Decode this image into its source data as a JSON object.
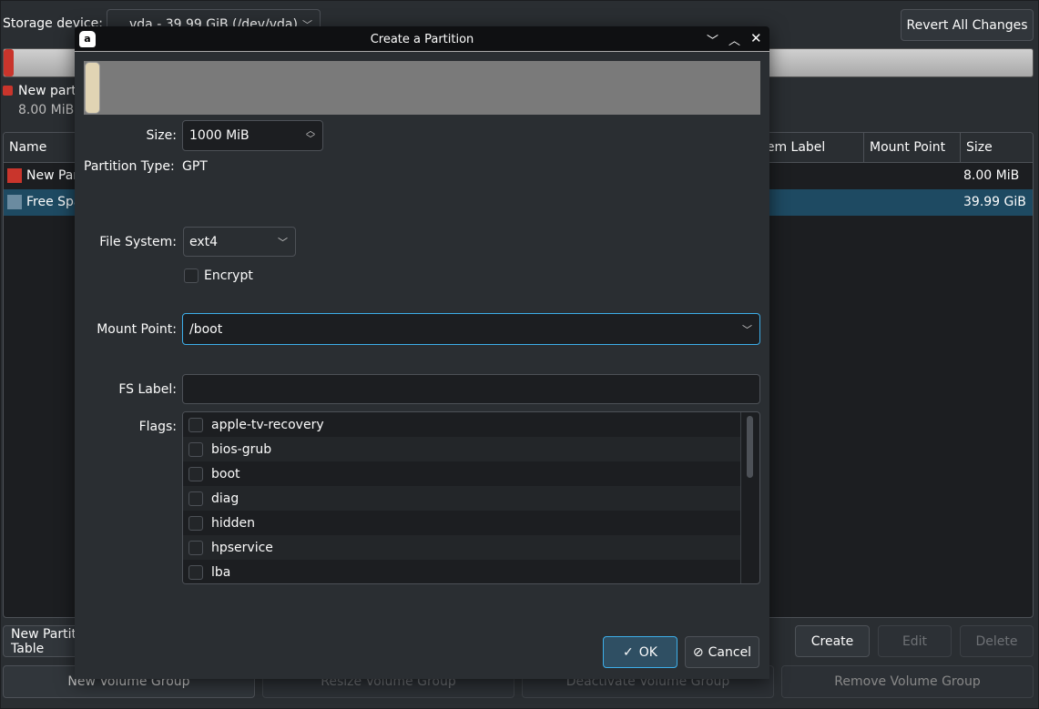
{
  "main": {
    "storage_label": "Storage device:",
    "storage_value": "vda - 39.99 GiB (/dev/vda)",
    "revert_button": "Revert All Changes",
    "legend": {
      "name": "New partition",
      "size": "8.00 MiB"
    },
    "table": {
      "columns": [
        "Name",
        "File System Label",
        "Mount Point",
        "Size"
      ],
      "rows": [
        {
          "name": "New Partition",
          "size": "8.00 MiB",
          "color": "#c9352c"
        },
        {
          "name": "Free Space",
          "size": "39.99 GiB",
          "color": "#6b8ba0"
        }
      ]
    },
    "buttons": {
      "new_partition": "New Partition Table",
      "create": "Create",
      "edit": "Edit",
      "delete": "Delete",
      "new_vg": "New Volume Group",
      "resize_vg": "Resize Volume Group",
      "deactivate_vg": "Deactivate Volume Group",
      "remove_vg": "Remove Volume Group"
    }
  },
  "dialog": {
    "title": "Create a Partition",
    "size_label": "Size:",
    "size_value": "1000 MiB",
    "ptype_label": "Partition Type:",
    "ptype_value": "GPT",
    "fs_label": "File System:",
    "fs_value": "ext4",
    "encrypt_label": "Encrypt",
    "mount_label": "Mount Point:",
    "mount_value": "/boot",
    "fslabel_label": "FS Label:",
    "fslabel_value": "",
    "flags_label": "Flags:",
    "flags": [
      "apple-tv-recovery",
      "bios-grub",
      "boot",
      "diag",
      "hidden",
      "hpservice",
      "lba"
    ],
    "ok": "OK",
    "cancel": "Cancel"
  },
  "colors": {
    "accent": "#3daee9",
    "selection": "#1e4a62",
    "ok_bg": "#2f4f63"
  }
}
